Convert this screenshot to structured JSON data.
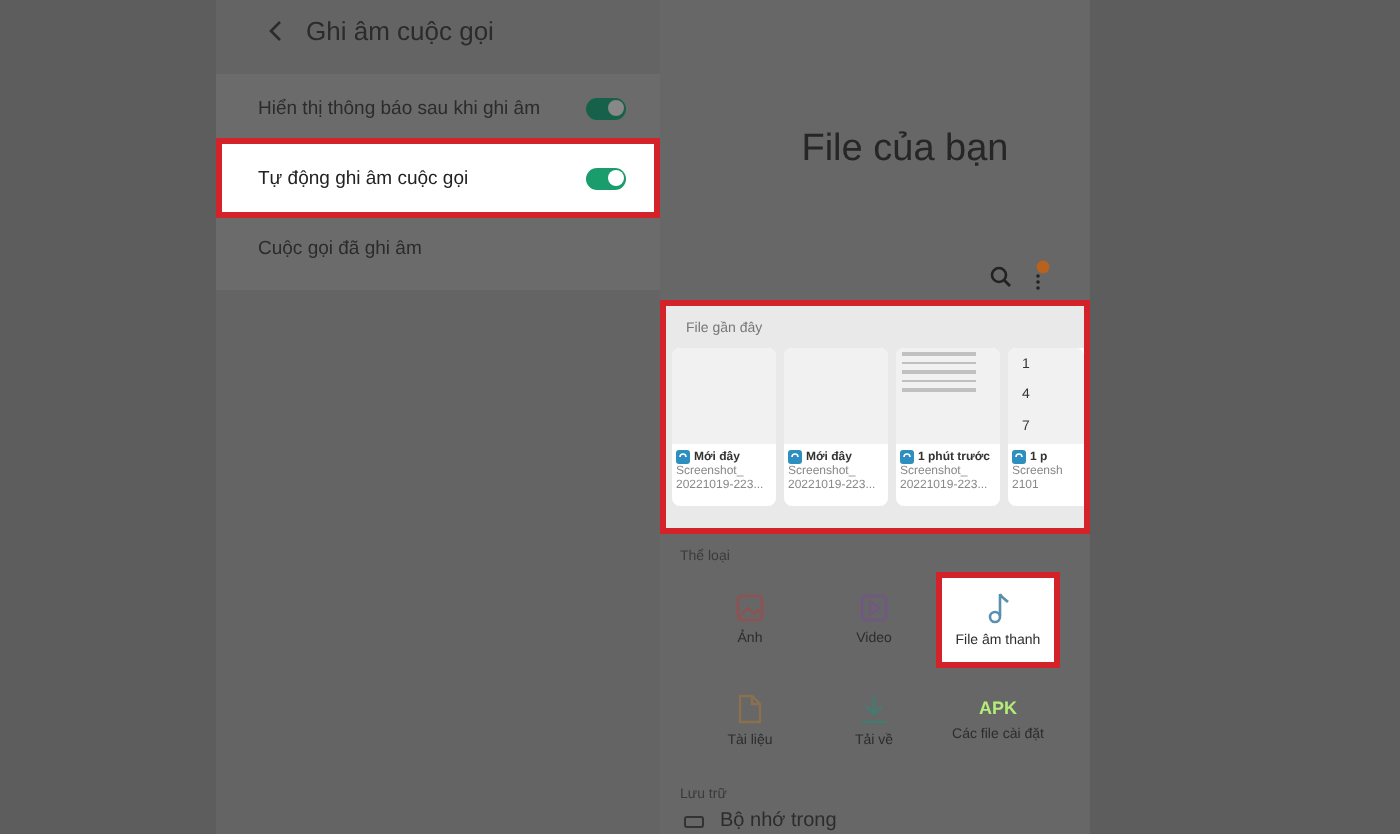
{
  "settings": {
    "title": "Ghi âm cuộc gọi",
    "rows": [
      {
        "kind": "toggle",
        "label": "Hiển thị thông báo sau khi ghi âm",
        "on": true,
        "highlighted": false
      },
      {
        "kind": "toggle",
        "label": "Tự động ghi âm cuộc gọi",
        "on": true,
        "highlighted": true
      },
      {
        "kind": "link",
        "label": "Cuộc gọi đã ghi âm",
        "highlighted": false
      }
    ]
  },
  "files": {
    "title": "File của bạn",
    "recent": {
      "title": "File gần đây",
      "highlighted": true,
      "items": [
        {
          "kind": "blank",
          "time": "Mới đây",
          "name": "Screenshot_",
          "date": "20221019-223..."
        },
        {
          "kind": "blank",
          "time": "Mới đây",
          "name": "Screenshot_",
          "date": "20221019-223..."
        },
        {
          "kind": "list",
          "time": "1 phút trước",
          "name": "Screenshot_",
          "date": "20221019-223..."
        },
        {
          "kind": "keypad",
          "time": "1 p",
          "name": "Screensh",
          "date": "2101",
          "keys": [
            "1",
            "4",
            "7"
          ]
        }
      ]
    },
    "categories": {
      "title": "Thể loại",
      "items": [
        {
          "kind": "image",
          "label": "Ảnh",
          "highlighted": false
        },
        {
          "kind": "video",
          "label": "Video",
          "highlighted": false
        },
        {
          "kind": "audio",
          "label": "File âm thanh",
          "highlighted": true
        },
        {
          "kind": "document",
          "label": "Tài liệu",
          "highlighted": false
        },
        {
          "kind": "download",
          "label": "Tải về",
          "highlighted": false
        },
        {
          "kind": "apk",
          "badge": "APK",
          "label": "Các file cài đặt",
          "highlighted": false
        }
      ]
    },
    "storage": {
      "title": "Lưu trữ",
      "items": [
        {
          "label": "Bộ nhớ trong"
        }
      ]
    }
  }
}
